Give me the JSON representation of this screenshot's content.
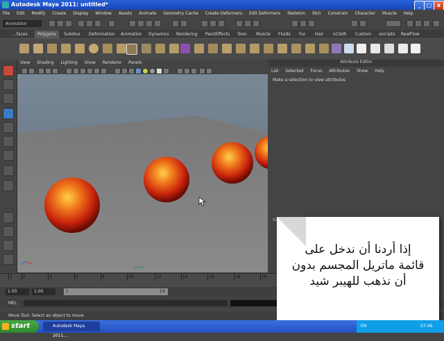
{
  "window": {
    "title": "Autodesk Maya 2011: untitled*",
    "minimize": "_",
    "maximize": "□",
    "close": "x"
  },
  "menubar": [
    "File",
    "Edit",
    "Modify",
    "Create",
    "Display",
    "Window",
    "Assets",
    "Animate",
    "Geometry Cache",
    "Create Deformers",
    "Edit Deformers",
    "Skeleton",
    "Skin",
    "Constrain",
    "Character",
    "Muscle",
    "Help"
  ],
  "statusline": {
    "mode": "Animation"
  },
  "shelf_tabs": [
    "...faces",
    "Polygons",
    "Subdivs",
    "Deformation",
    "Animation",
    "Dynamics",
    "Rendering",
    "PaintEffects",
    "Toon",
    "Muscle",
    "Fluids",
    "Fur",
    "Hair",
    "nCloth",
    "Custom",
    "xscripts",
    "RealFlow"
  ],
  "shelf_active": "Polygons",
  "viewport": {
    "menu": [
      "View",
      "Shading",
      "Lighting",
      "Show",
      "Renderer",
      "Panels"
    ],
    "camera_label": "persp"
  },
  "attribute_editor": {
    "title": "Attribute Editor",
    "menu": [
      "List",
      "Selected",
      "Focus",
      "Attributes",
      "Show",
      "Help"
    ],
    "hint": "Make a selection to view attributes",
    "notes_label": "Notes:"
  },
  "timeslider": {
    "ticks": [
      "1",
      "2",
      "4",
      "6",
      "8",
      "10",
      "12",
      "14",
      "16",
      "18",
      "20"
    ]
  },
  "range": {
    "start": "1.00",
    "inner_start": "1.00",
    "range_start": "1",
    "range_end": "24"
  },
  "command_line": {
    "label": "MEL"
  },
  "help_line": "Move Tool: Select an object to move.",
  "callout": {
    "text": "إذا أردنا أن ندخل على\nقائمة ماتريل المجسم بدون\nأن نذهب للهيبر شيد"
  },
  "taskbar": {
    "start": "start",
    "task": "Autodesk Maya 2011...",
    "lang": "EN",
    "clock": "07:46"
  },
  "colors": {
    "titlebar": "#2a62d9",
    "viewport_bg": "#6e7e8e",
    "sphere": "#e8491a",
    "taskbar": "#2451c4",
    "start": "#3c9a3a"
  }
}
